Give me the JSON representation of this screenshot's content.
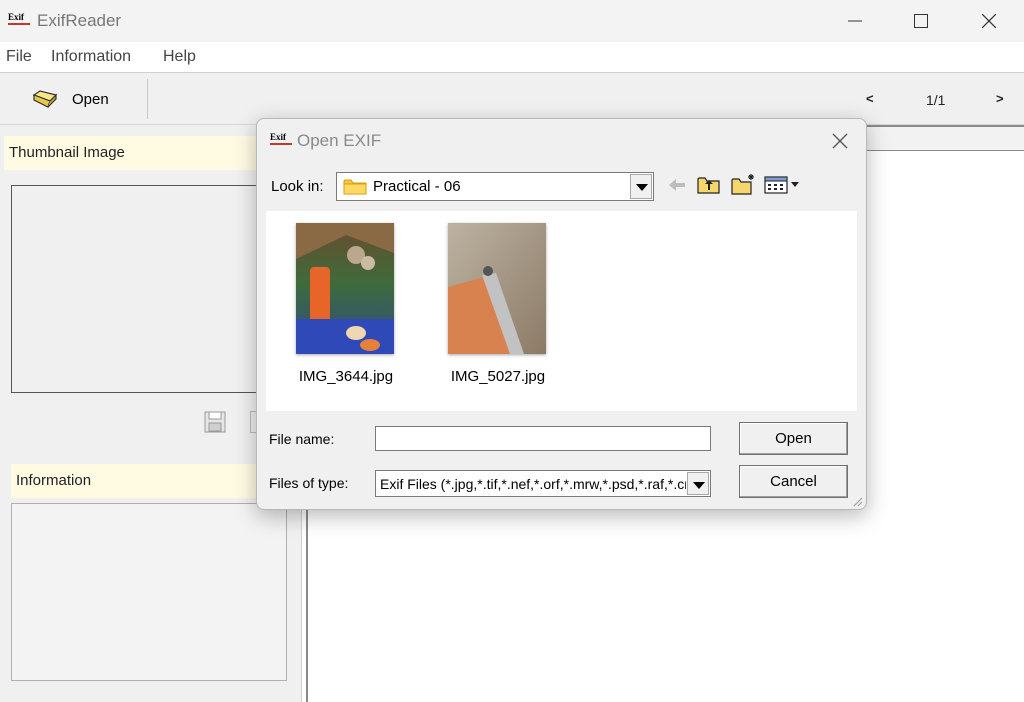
{
  "window": {
    "title": "ExifReader",
    "logo_text": "Exif"
  },
  "menu": {
    "file": "File",
    "information": "Information",
    "help": "Help"
  },
  "toolbar": {
    "open_label": "Open",
    "prev": "<",
    "page": "1/1",
    "next": ">"
  },
  "left_panel": {
    "thumbnail_header": "Thumbnail Image",
    "information_header": "Information"
  },
  "dialog": {
    "title": "Open EXIF",
    "logo_text": "Exif",
    "look_in_label": "Look in:",
    "look_in_value": "Practical - 06",
    "files": [
      {
        "name": "IMG_3644.jpg"
      },
      {
        "name": "IMG_5027.jpg"
      }
    ],
    "file_name_label": "File name:",
    "file_name_value": "",
    "files_of_type_label": "Files of type:",
    "files_of_type_value": "Exif Files (*.jpg,*.tif,*.nef,*.orf,*.mrw,*.psd,*.raf,*.crw)",
    "open_button": "Open",
    "cancel_button": "Cancel"
  },
  "icons": {
    "open": "open-folder-icon",
    "back": "back-arrow-icon",
    "up": "up-folder-icon",
    "new_folder": "new-folder-icon",
    "view_menu": "view-menu-icon",
    "save": "save-icon"
  },
  "colors": {
    "header_bg": "#fffbe3",
    "folder": "#f5c542"
  }
}
